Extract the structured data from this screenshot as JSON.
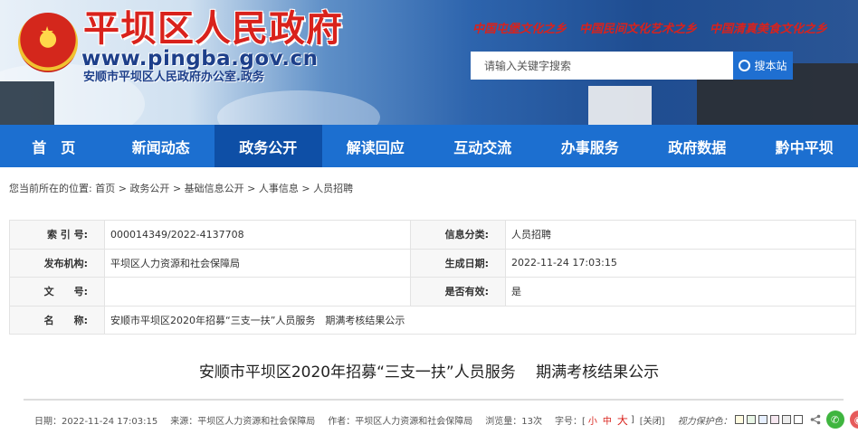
{
  "header": {
    "site_title": "平坝区人民政府",
    "site_url": "www.pingba.gov.cn",
    "site_subtitle": "安顺市平坝区人民政府办公室.政务",
    "slogans": [
      "中国屯堡文化之乡",
      "中国民间文化艺术之乡",
      "中国清真美食文化之乡"
    ],
    "search_placeholder": "请输入关键字搜索",
    "search_button": "搜本站"
  },
  "nav": {
    "items": [
      "首　页",
      "新闻动态",
      "政务公开",
      "解读回应",
      "互动交流",
      "办事服务",
      "政府数据",
      "黔中平坝"
    ],
    "active_index": 2
  },
  "breadcrumb": {
    "prefix": "您当前所在的位置:",
    "items": [
      "首页",
      "政务公开",
      "基础信息公开",
      "人事信息",
      "人员招聘"
    ],
    "separator": ">"
  },
  "info": {
    "index_label": "索 引 号:",
    "index_value": "000014349/2022-4137708",
    "category_label": "信息分类:",
    "category_value": "人员招聘",
    "publisher_label": "发布机构:",
    "publisher_value": "平坝区人力资源和社会保障局",
    "date_label": "生成日期:",
    "date_value": "2022-11-24 17:03:15",
    "docno_label": "文　　号:",
    "docno_value": "",
    "valid_label": "是否有效:",
    "valid_value": "是",
    "name_label": "名　　称:",
    "name_value": "安顺市平坝区2020年招募“三支一扶”人员服务　期满考核结果公示"
  },
  "document": {
    "title": "安顺市平坝区2020年招募“三支一扶”人员服务　 期满考核结果公示"
  },
  "meta": {
    "date": "日期：2022-11-24 17:03:15",
    "source": "来源：平坝区人力资源和社会保障局",
    "author": "作者：平坝区人力资源和社会保障局",
    "views": "浏览量：13次",
    "font_label": "字号：[",
    "font_small": "小",
    "font_medium": "中",
    "font_large": "大",
    "font_end": "]",
    "close": "[关闭]",
    "vision_label": "视力保护色：",
    "swatches": [
      "#fffbe0",
      "#e8f6e6",
      "#e6efff",
      "#f5e6ef",
      "#ececec",
      "#ffffff"
    ]
  }
}
